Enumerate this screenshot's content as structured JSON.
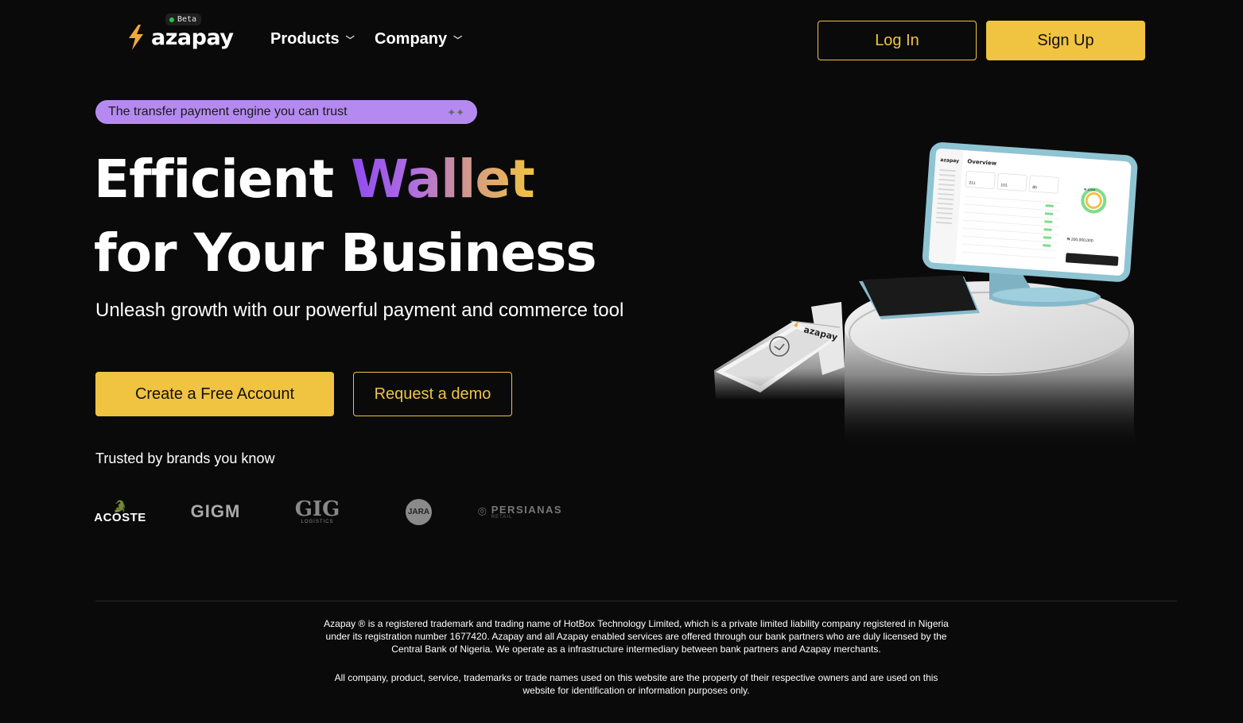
{
  "nav": {
    "logo_text": "azapay",
    "beta_label": "Beta",
    "products_label": "Products",
    "company_label": "Company",
    "login_label": "Log In",
    "signup_label": "Sign Up"
  },
  "hero": {
    "tagline": "The transfer payment engine you can trust",
    "headline_part1": "Efficient",
    "headline_highlight": "Wallet",
    "headline_line2": "for Your Business",
    "subtitle": "Unleash growth with our powerful payment and commerce tool",
    "cta_primary": "Create a Free Account",
    "cta_secondary": "Request a demo",
    "trusted_label": "Trusted by brands you know"
  },
  "brands": {
    "lacoste": "ACOSTE",
    "gigm": "GIGM",
    "gig_main": "GIG",
    "gig_sub": "LOGISTICS",
    "jara": "JARA",
    "persianas_main": "PERSIANAS",
    "persianas_sub": "RETAIL"
  },
  "device_screen": {
    "logo": "azapay",
    "title": "Overview",
    "stat1": "211",
    "stat2": "101",
    "stat3": "85",
    "amount_big": "₦ 200,000,000",
    "donut_label": "₦ 100M",
    "terminal_logo": "azapay"
  },
  "footer": {
    "legal_p1": "Azapay ® is a registered trademark and trading name of HotBox Technology Limited, which is a private limited liability company registered in Nigeria under its registration number 1677420. Azapay and all Azapay enabled services are offered through our bank partners who are duly licensed by the Central Bank of Nigeria. We operate as a infrastructure intermediary between bank partners and Azapay merchants.",
    "legal_p2": "All company, product, service, trademarks or trade names used on this website are the property of their respective owners and are used on this website for identification or information purposes only."
  },
  "colors": {
    "accent": "#f0c341",
    "tagline_bg": "#b58af0",
    "background": "#0a0a0a"
  }
}
